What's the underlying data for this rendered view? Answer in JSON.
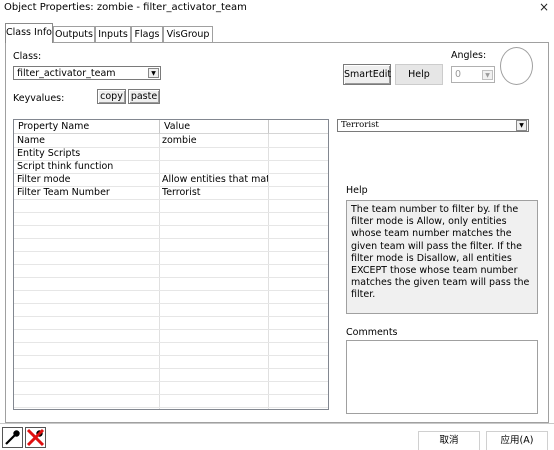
{
  "window": {
    "title": "Object Properties: zombie - filter_activator_team",
    "close_glyph": "×"
  },
  "tabs": [
    {
      "label": "Class Info"
    },
    {
      "label": "Outputs"
    },
    {
      "label": "Inputs"
    },
    {
      "label": "Flags"
    },
    {
      "label": "VisGroup"
    }
  ],
  "class_section": {
    "class_label": "Class:",
    "class_value": "filter_activator_team",
    "keyvalues_label": "Keyvalues:",
    "copy_label": "copy",
    "paste_label": "paste",
    "smartedit_label": "SmartEdit",
    "help_label": "Help",
    "angles_label": "Angles:",
    "angles_value": "0"
  },
  "keyvalues": {
    "headers": [
      "Property Name",
      "Value"
    ],
    "rows": [
      {
        "name": "Name",
        "value": "zombie"
      },
      {
        "name": "Entity Scripts",
        "value": ""
      },
      {
        "name": "Script think function",
        "value": ""
      },
      {
        "name": "Filter mode",
        "value": "Allow entities that match c"
      },
      {
        "name": "Filter Team Number",
        "value": "Terrorist"
      }
    ]
  },
  "value_editor": {
    "selected_value": "Terrorist"
  },
  "help": {
    "label": "Help",
    "text": "The team number to filter by.  If the filter mode is Allow, only entities whose team number matches the given team will pass the filter. If the filter mode is Disallow, all entities EXCEPT those whose team number matches the given team will pass the filter."
  },
  "comments": {
    "label": "Comments",
    "value": ""
  },
  "footer": {
    "cancel_label": "取消",
    "apply_label": "应用(A)"
  },
  "icons": {
    "tool_1": "pick-entity-icon",
    "tool_2": "pick-disabled-icon"
  }
}
